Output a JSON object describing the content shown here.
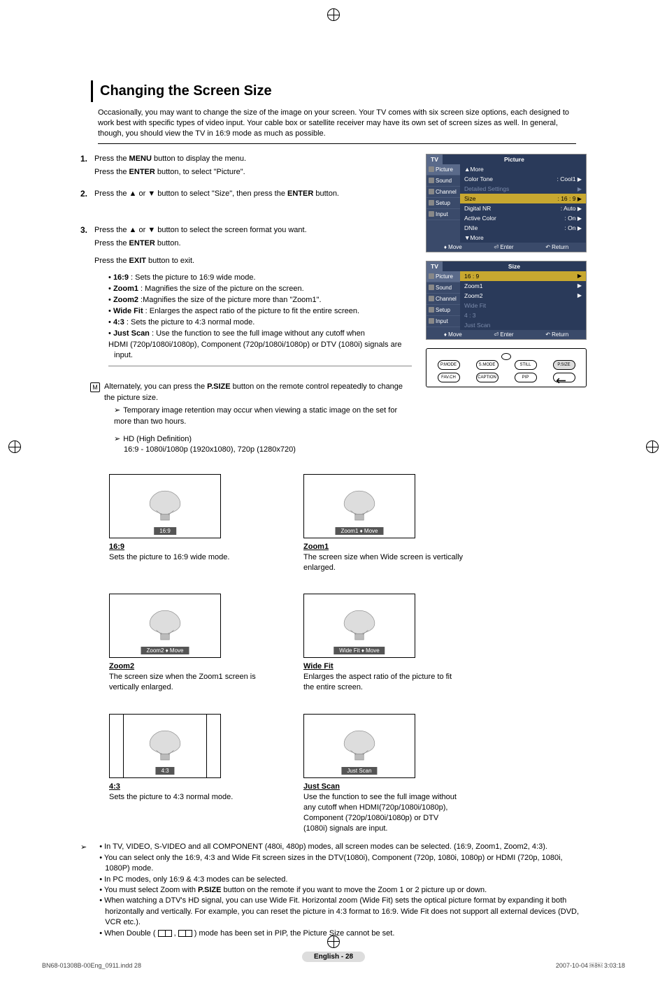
{
  "page": {
    "title": "Changing the Screen Size",
    "intro": "Occasionally, you may want to change the size of the image on your screen.  Your TV comes with six screen size options, each designed to work best with specific types of video input.  Your cable box or satellite receiver may have its own set of screen sizes as well. In general, though, you should view the TV in 16:9 mode as much as possible.",
    "page_label": "English - 28"
  },
  "steps": {
    "s1a": "Press the ",
    "s1b": " button to display the menu.",
    "s1c": "Press the ",
    "s1d": " button, to select \"Picture\".",
    "s2a": "Press the ▲ or ▼ button to select \"Size\", then press the ",
    "s2b": " button.",
    "s3a": "Press the ▲ or ▼ button to select the screen format you want.",
    "s3b": "Press the ",
    "s3c": " button.",
    "s3d": "Press the ",
    "s3e": " button to exit.",
    "menu": "MENU",
    "enter": "ENTER",
    "exit": "EXIT"
  },
  "bullets": {
    "b1": "• 16:9 : Sets the picture to 16:9 wide mode.",
    "b2": "• Zoom1 : Magnifies the size of the picture on the screen.",
    "b3": "• Zoom2 :Magnifies the size of the picture more than \"Zoom1\".",
    "b4": "• Wide Fit : Enlarges the aspect ratio of the picture to fit the entire screen.",
    "b5": "• 4:3 : Sets the picture to 4:3 normal mode.",
    "b6a": "• Just Scan : Use the function to see the full image without any cutoff when",
    "b6b": "HDMI (720p/1080i/1080p), Component (720p/1080i/1080p) or DTV (1080i) signals are input.",
    "b1_label": "16:9",
    "b2_label": "Zoom1",
    "b3_label": "Zoom2",
    "b4_label": "Wide Fit",
    "b5_label": "4:3",
    "b6_label": "Just Scan"
  },
  "alt": {
    "icon": "M",
    "text_a": "Alternately, you can press the ",
    "psize": "P.SIZE",
    "text_b": " button on the remote control repeatedly to change the picture size.",
    "note1": "Temporary image retention may occur when viewing a static image on the set for more than two hours.",
    "note2a": "HD (High Definition)",
    "note2b": "16:9 - 1080i/1080p (1920x1080), 720p (1280x720)"
  },
  "osd1": {
    "tv": "TV",
    "title": "Picture",
    "tabs": [
      "Picture",
      "Sound",
      "Channel",
      "Setup",
      "Input"
    ],
    "rows": [
      {
        "label": "▲More",
        "val": ""
      },
      {
        "label": "Color Tone",
        "val": ": Cool1"
      },
      {
        "label": "Detailed Settings",
        "val": "",
        "dim": true
      },
      {
        "label": "Size",
        "val": ": 16 : 9",
        "sel": true
      },
      {
        "label": "Digital NR",
        "val": ": Auto"
      },
      {
        "label": "Active Color",
        "val": ": On"
      },
      {
        "label": "DNIe",
        "val": ": On"
      },
      {
        "label": "▼More",
        "val": ""
      }
    ],
    "footer": {
      "move": "Move",
      "enter": "Enter",
      "return": "Return"
    }
  },
  "osd2": {
    "tv": "TV",
    "title": "Size",
    "tabs": [
      "Picture",
      "Sound",
      "Channel",
      "Setup",
      "Input"
    ],
    "rows": [
      {
        "label": "16 : 9",
        "sel": true
      },
      {
        "label": "Zoom1"
      },
      {
        "label": "Zoom2"
      },
      {
        "label": "Wide Fit",
        "dim": true
      },
      {
        "label": "4 : 3",
        "dim": true
      },
      {
        "label": "Just Scan",
        "dim": true
      }
    ],
    "footer": {
      "move": "Move",
      "enter": "Enter",
      "return": "Return"
    }
  },
  "remote": {
    "row1": [
      "P.MODE",
      "S.MODE",
      "STILL",
      "P.SIZE"
    ],
    "row2": [
      "FAV.CH",
      "CAPTION",
      "PIP",
      ""
    ]
  },
  "modes": [
    {
      "label": "16:9",
      "bar": "16:9",
      "title": "16:9",
      "desc": "Sets the picture to 16:9 wide mode."
    },
    {
      "label": "Zoom1",
      "bar": "Zoom1 ♦ Move",
      "title": "Zoom1",
      "desc": "The screen size when Wide screen is vertically enlarged."
    },
    {
      "label": "Zoom2",
      "bar": "Zoom2 ♦ Move",
      "title": "Zoom2",
      "desc": "The screen size when the Zoom1 screen is vertically enlarged."
    },
    {
      "label": "WideFit",
      "bar": "Wide Fit ♦ Move",
      "title": "Wide Fit",
      "desc": "Enlarges the aspect ratio of the picture to fit the entire screen."
    },
    {
      "label": "4:3",
      "bar": "4:3",
      "title": "4:3",
      "desc": "Sets the picture to 4:3 normal mode.",
      "narrow": true
    },
    {
      "label": "JustScan",
      "bar": "Just Scan",
      "title": "Just Scan",
      "desc": "Use the function to see the full image without any cutoff when HDMI(720p/1080i/1080p), Component (720p/1080i/1080p) or DTV (1080i) signals are input."
    }
  ],
  "final": [
    "• In TV, VIDEO, S-VIDEO and all COMPONENT (480i, 480p) modes, all screen modes can be selected. (16:9, Zoom1, Zoom2, 4:3).",
    "• You can select only the 16:9, 4:3 and Wide Fit screen sizes in the DTV(1080i), Component (720p, 1080i, 1080p) or HDMI (720p, 1080i, 1080P) mode.",
    "• In PC modes, only 16:9 & 4:3 modes can be selected.",
    "• You must select Zoom with P.SIZE button on the remote if you want to move the Zoom 1 or 2 picture up or down.",
    "• When watching a DTV's HD signal, you can use Wide Fit. Horizontal zoom (Wide Fit) sets the optical picture format by expanding it both horizontally and vertically. For example, you can reset the picture in 4:3 format to 16:9. Wide Fit does not support all external devices (DVD, VCR etc.)."
  ],
  "final_last_a": "• When Double ( ",
  "final_last_b": " , ",
  "final_last_c": " ) mode has been set in PIP, the Picture Size cannot be set.",
  "final_psize": "P.SIZE",
  "footer": {
    "file": "BN68-01308B-00Eng_0911.indd   28",
    "date": "2007-10-04   ￼￼ 3:03:18"
  }
}
